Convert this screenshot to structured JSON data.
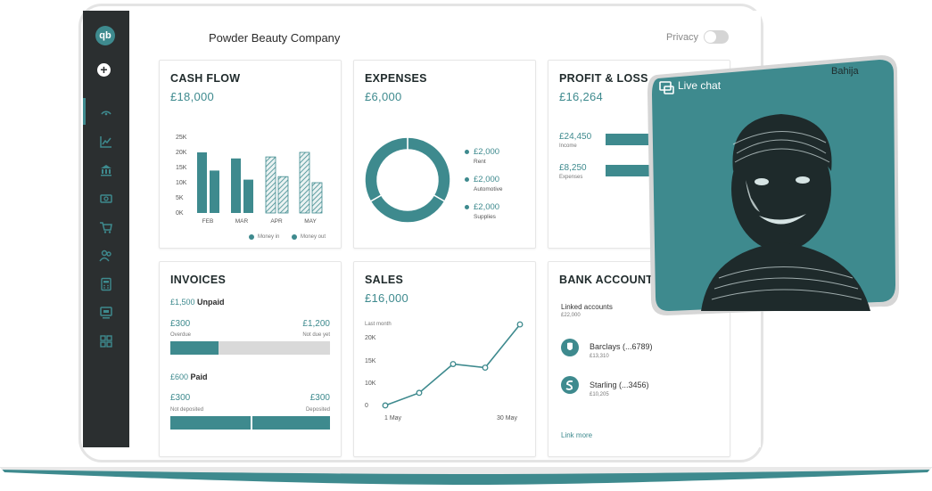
{
  "company_name": "Powder Beauty Company",
  "privacy": {
    "label": "Privacy",
    "enabled": false
  },
  "colors": {
    "accent": "#3e8a8e",
    "sidebar": "#2b2f30",
    "track": "#d9d9d9"
  },
  "sidebar": {
    "logo": "qb",
    "items": [
      {
        "name": "add-icon"
      },
      {
        "name": "dashboard-icon"
      },
      {
        "name": "chart-icon"
      },
      {
        "name": "bank-icon"
      },
      {
        "name": "money-icon"
      },
      {
        "name": "cart-icon"
      },
      {
        "name": "people-icon"
      },
      {
        "name": "calculator-icon"
      },
      {
        "name": "monitor-icon"
      },
      {
        "name": "apps-icon"
      }
    ]
  },
  "cash_flow": {
    "title": "CASH FLOW",
    "amount": "£18,000",
    "legend_in": "Money in",
    "legend_out": "Money out",
    "chart_data": {
      "type": "bar",
      "categories": [
        "FEB",
        "MAR",
        "APR",
        "MAY"
      ],
      "series": [
        {
          "name": "Money in",
          "values": [
            20,
            18,
            18.5,
            20
          ]
        },
        {
          "name": "Money out",
          "values": [
            14,
            11,
            12,
            10
          ]
        }
      ],
      "y_ticks": [
        "25K",
        "20K",
        "15K",
        "10K",
        "5K",
        "0K"
      ],
      "ylim": [
        0,
        25
      ]
    }
  },
  "expenses": {
    "title": "EXPENSES",
    "amount": "£6,000",
    "chart_data": {
      "type": "pie",
      "slices": [
        {
          "amount": "£2,000",
          "label": "Rent",
          "value": 2000
        },
        {
          "amount": "£2,000",
          "label": "Automotive",
          "value": 2000
        },
        {
          "amount": "£2,000",
          "label": "Supplies",
          "value": 2000
        }
      ]
    }
  },
  "profit_loss": {
    "title": "PROFIT & LOSS",
    "amount": "£16,264",
    "income_amount": "£24,450",
    "income_label": "Income",
    "expenses_amount": "£8,250",
    "expenses_label": "Expenses"
  },
  "invoices": {
    "title": "INVOICES",
    "unpaid_amount": "£1,500",
    "unpaid_label": "Unpaid",
    "overdue_amount": "£300",
    "overdue_label": "Overdue",
    "notdue_amount": "£1,200",
    "notdue_label": "Not due yet",
    "unpaid_progress": 0.3,
    "paid_amount": "£600",
    "paid_label": "Paid",
    "notdeposited_amount": "£300",
    "notdeposited_label": "Not deposited",
    "deposited_amount": "£300",
    "deposited_label": "Deposited",
    "paid_progress": 0.5
  },
  "sales": {
    "title": "SALES",
    "amount": "£16,000",
    "period": "Last month",
    "chart_data": {
      "type": "line",
      "x_labels": [
        "1 May",
        "30 May"
      ],
      "values": [
        0.5,
        4,
        12,
        11,
        23
      ],
      "y_ticks": [
        "20K",
        "15K",
        "10K",
        "0"
      ],
      "ylim": [
        0,
        25
      ]
    }
  },
  "bank_accounts": {
    "title": "BANK ACCOUNTS",
    "linked_label": "Linked accounts",
    "linked_total": "£22,000",
    "accounts": [
      {
        "name": "Barclays (...6789)",
        "balance": "£13,310"
      },
      {
        "name": "Starling (...3456)",
        "balance": "£10,205"
      }
    ],
    "link_more": "Link more"
  },
  "live_chat": {
    "label": "Live chat",
    "agent": "Bahija"
  }
}
